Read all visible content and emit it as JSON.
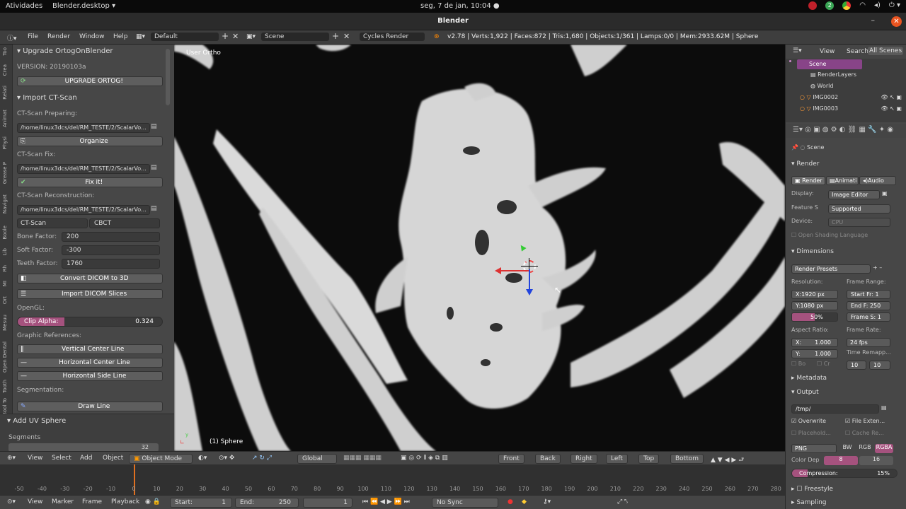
{
  "gnome": {
    "activities": "Atividades",
    "app": "Blender.desktop ▾",
    "clock": "seg,  7 de jan, 10:04 ●",
    "badge": "2"
  },
  "window": {
    "title": "Blender"
  },
  "infobar": {
    "menus": [
      "File",
      "Render",
      "Window",
      "Help"
    ],
    "layout": "Default",
    "scene": "Scene",
    "engine": "Cycles Render",
    "stats": "v2.78 | Verts:1,922 | Faces:872 | Tris:1,680 | Objects:1/361 | Lamps:0/0 | Mem:2933.62M | Sphere"
  },
  "left": {
    "tabs": [
      "Too",
      "Crea",
      "Relati",
      "Animat",
      "Physi",
      "Grease P",
      "Navigat",
      "Boole",
      "Lib",
      "Rh",
      "MI",
      "Ort",
      "Mesuu",
      "Open Dental",
      "Tooth",
      "Bool To"
    ],
    "upgrade_header": "Upgrade OrtogOnBlender",
    "version": "VERSION: 20190103a",
    "upgrade_btn": "UPGRADE ORTOG!",
    "import_header": "Import CT-Scan",
    "prep_label": "CT-Scan Preparing:",
    "prep_path": "/home/linux3dcs/del/RM_TESTE/2/ScalarVo...",
    "organize": "Organize",
    "fix_label": "CT-Scan Fix:",
    "fix_path": "/home/linux3dcs/del/RM_TESTE/2/ScalarVo...",
    "fix_btn": "Fix it!",
    "recon_label": "CT-Scan Reconstruction:",
    "recon_path": "/home/linux3dcs/del/RM_TESTE/2/ScalarVo...",
    "ctscan": "CT-Scan",
    "cbct": "CBCT",
    "bone_label": "Bone Factor:",
    "bone_val": "200",
    "soft_label": "Soft Factor:",
    "soft_val": "-300",
    "teeth_label": "Teeth Factor:",
    "teeth_val": "1760",
    "convert": "Convert DICOM to 3D",
    "import_slices": "Import DICOM Slices",
    "opengl": "OpenGL:",
    "clip_label": "Clip Alpha:",
    "clip_val": "0.324",
    "clip_fraction": 0.324,
    "graphic": "Graphic References:",
    "vcl": "Vertical Center Line",
    "hcl": "Horizontal Center Line",
    "hsl": "Horizontal Side Line",
    "segmentation": "Segmentation:",
    "draw_line": "Draw Line",
    "uv_header": "Add UV Sphere",
    "segments_label": "Segments",
    "segments_val": "32"
  },
  "viewport": {
    "label": "User Ortho",
    "object": "(1) Sphere"
  },
  "outliner": {
    "tabs": [
      "View",
      "Search",
      "All Scenes"
    ],
    "items": [
      "Scene",
      "RenderLayers",
      "World",
      "IMG0002",
      "IMG0003"
    ]
  },
  "props": {
    "scene": "Scene",
    "render_header": "Render",
    "render_btn": "Render",
    "anim_btn": "Animati",
    "audio_btn": "Audio",
    "display_label": "Display:",
    "display_val": "Image Editor",
    "feature_label": "Feature S",
    "feature_val": "Supported",
    "device_label": "Device:",
    "device_val": "CPU",
    "osl": "Open Shading Language",
    "dims_header": "Dimensions",
    "presets": "Render Presets",
    "res_label": "Resolution:",
    "frame_range": "Frame Range:",
    "resx": "X:1920 px",
    "resy": "Y:1080 px",
    "respct": "50%",
    "start": "Start Fr: 1",
    "end": "End F: 250",
    "step": "Frame S: 1",
    "aspect": "Aspect Ratio:",
    "framerate": "Frame Rate:",
    "ax": "X:",
    "ax_val": "1.000",
    "ay": "Y:",
    "ay_val": "1.000",
    "fps": "24 fps",
    "remap": "Time Remapp...",
    "bo": "Bo",
    "cr": "Cr",
    "remap_old": "10",
    "remap_new": "10",
    "metadata": "Metadata",
    "output": "Output",
    "outpath": "/tmp/",
    "overwrite": "Overwrite",
    "fileext": "File Exten...",
    "placeholders": "Placehold...",
    "cache": "Cache Re...",
    "format": "PNG",
    "bw": "BW",
    "rgb": "RGB",
    "rgba": "RGBA",
    "colordepth": "Color Dep",
    "cd8": "8",
    "cd16": "16",
    "compression": "Compression:",
    "compression_val": "15%",
    "freestyle": "Freestyle",
    "sampling": "Sampling"
  },
  "vhead": {
    "view": "View",
    "select": "Select",
    "add": "Add",
    "object": "Object",
    "mode": "Object Mode",
    "orient": "Global",
    "front": "Front",
    "back": "Back",
    "right": "Right",
    "left": "Left",
    "top": "Top",
    "bottom": "Bottom"
  },
  "ruler": [
    "-50",
    "-40",
    "-30",
    "-20",
    "-10",
    "0",
    "10",
    "20",
    "30",
    "40",
    "50",
    "60",
    "70",
    "80",
    "90",
    "100",
    "110",
    "120",
    "130",
    "140",
    "150",
    "160",
    "170",
    "180",
    "190",
    "200",
    "210",
    "220",
    "230",
    "240",
    "250",
    "260",
    "270",
    "280"
  ],
  "tlhead": {
    "view": "View",
    "marker": "Marker",
    "frame": "Frame",
    "playback": "Playback",
    "start_label": "Start:",
    "start_val": "1",
    "end_label": "End:",
    "end_val": "250",
    "cur": "1",
    "sync": "No Sync"
  }
}
